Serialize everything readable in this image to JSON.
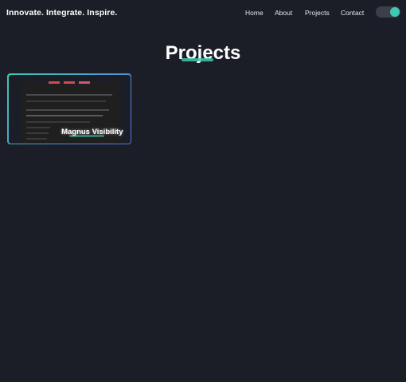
{
  "header": {
    "brand": "Innovate. Integrate. Inspire.",
    "nav": [
      "Home",
      "About",
      "Projects",
      "Contact"
    ],
    "theme_toggle_on": true
  },
  "colors": {
    "background": "#1b1e27",
    "accent": "#3ec9b0",
    "accent_secondary": "#5b6fe6"
  },
  "main": {
    "title": "Projects",
    "projects": [
      {
        "name": "Magnus Visibility"
      }
    ]
  }
}
